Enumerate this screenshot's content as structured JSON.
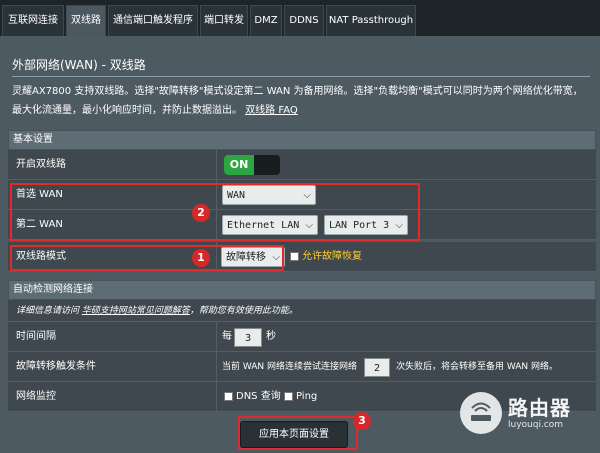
{
  "tabs": [
    {
      "label": "互联网连接"
    },
    {
      "label": "双线路"
    },
    {
      "label": "通信端口触发程序"
    },
    {
      "label": "端口转发"
    },
    {
      "label": "DMZ"
    },
    {
      "label": "DDNS"
    },
    {
      "label": "NAT Passthrough"
    }
  ],
  "page": {
    "title": "外部网络(WAN) - 双线路",
    "description": "灵耀AX7800 支持双线路。选择\"故障转移\"模式设定第二 WAN 为备用网络。选择\"负载均衡\"模式可以同时为两个网络优化带宽，最大化流通量，最小化响应时间，并防止数据溢出。",
    "faq_link": "双线路 FAQ"
  },
  "basic": {
    "header": "基本设置",
    "dual_wan_label": "开启双线路",
    "toggle_on": "ON",
    "primary_wan_label": "首选 WAN",
    "primary_wan_value": "WAN",
    "secondary_wan_label": "第二 WAN",
    "secondary_wan_value": "Ethernet LAN",
    "secondary_port_value": "LAN Port 3",
    "mode_label": "双线路模式",
    "mode_value": "故障转移",
    "failback_label": "允许故障恢复"
  },
  "detect": {
    "header": "自动检测网络连接",
    "note_prefix": "详细信息请访问",
    "note_link": "华硕支持网站常见问题解答",
    "note_suffix": "，帮助您有效使用此功能。",
    "interval_label": "时间间隔",
    "interval_prefix": "每",
    "interval_value": "3",
    "interval_unit": "秒",
    "trigger_label": "故障转移触发条件",
    "trigger_prefix": "当前 WAN 网络连续尝试连接网络",
    "trigger_value": "2",
    "trigger_suffix": "次失败后，将会转移至备用 WAN 网络。",
    "monitor_label": "网络监控",
    "dns_label": "DNS 查询",
    "ping_label": "Ping"
  },
  "apply_label": "应用本页面设置",
  "badges": [
    "1",
    "2",
    "3"
  ],
  "watermark": {
    "name": "路由器",
    "url": "luyouqi.com"
  }
}
